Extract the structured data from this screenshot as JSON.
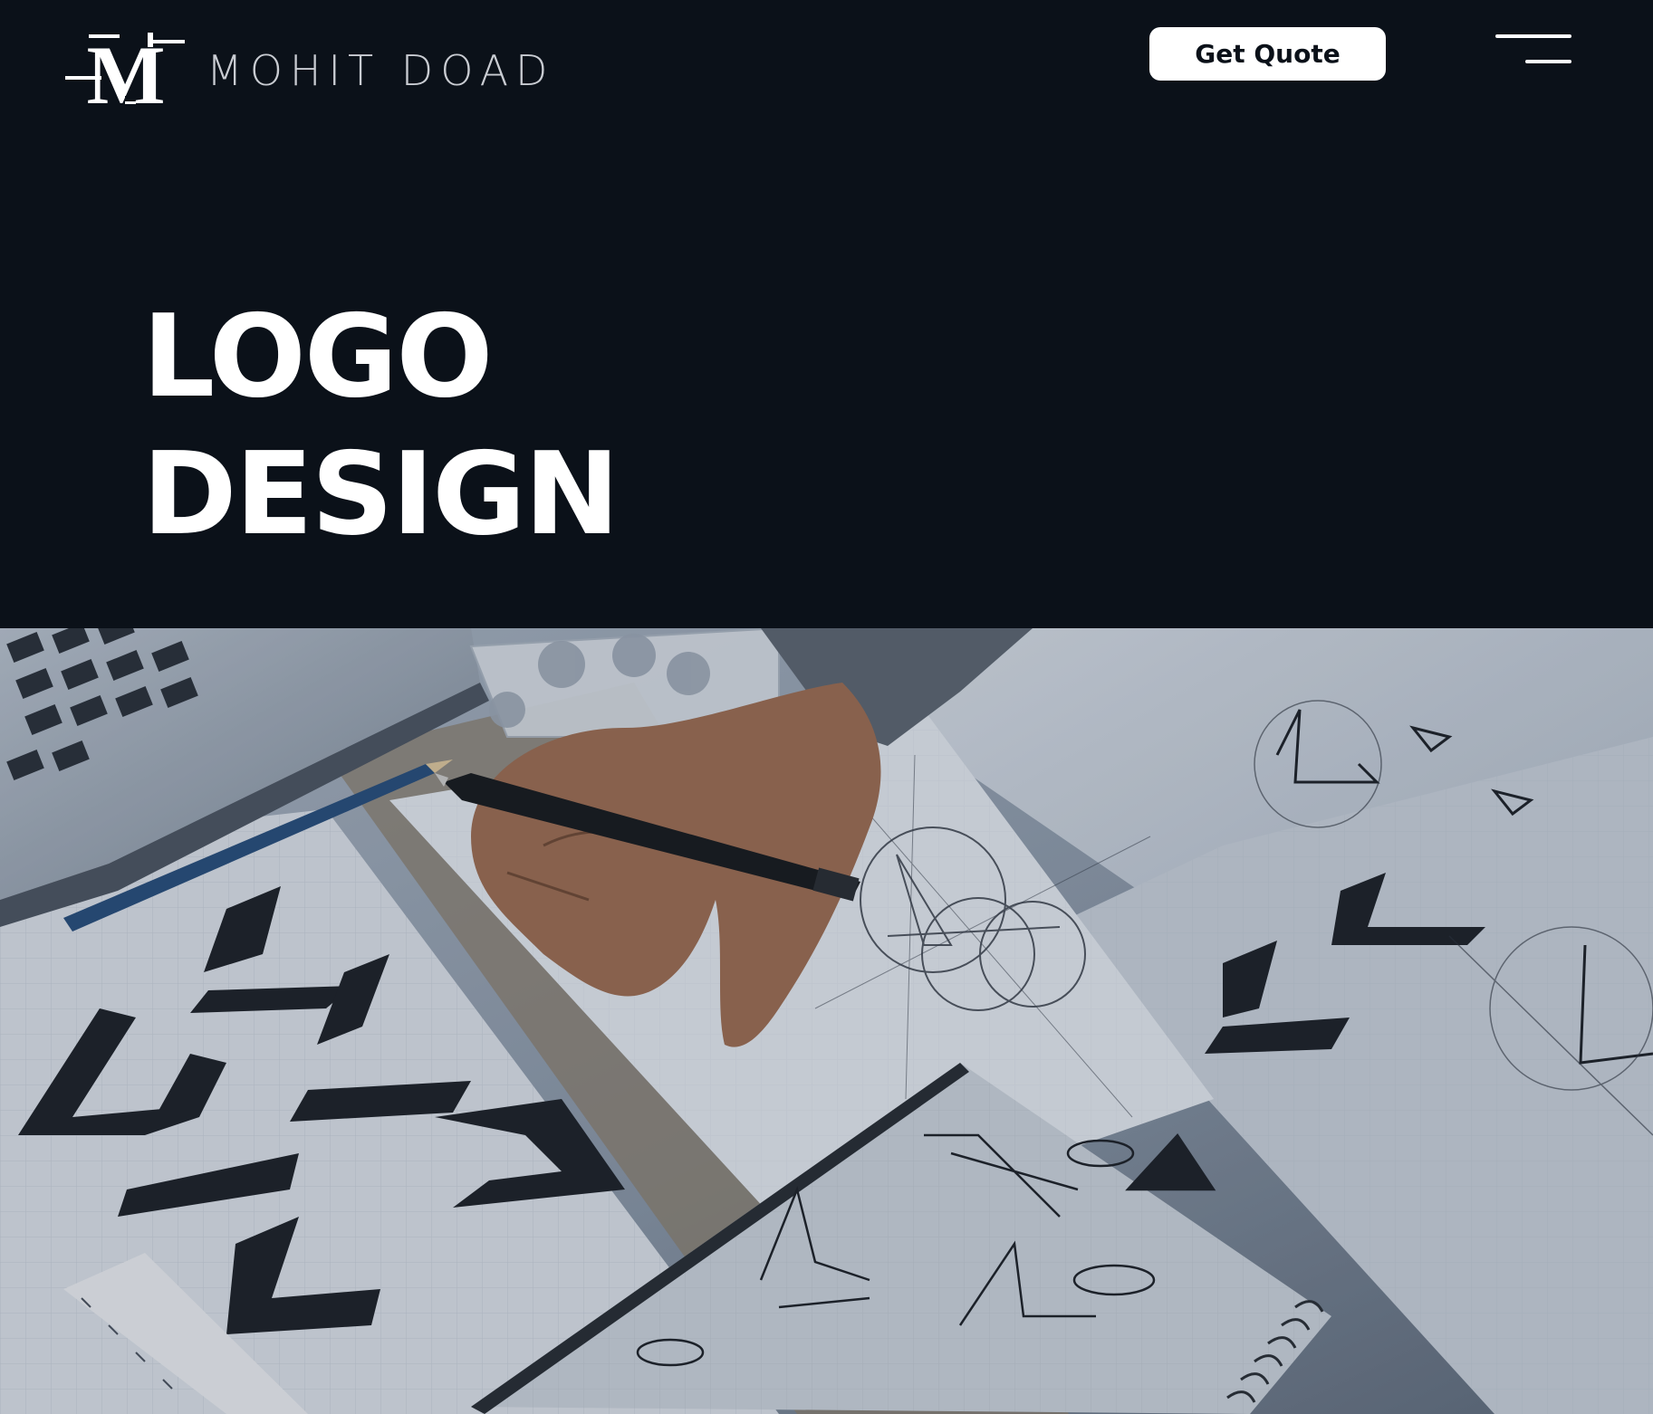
{
  "header": {
    "logo_letter": "M",
    "brand_name": "MOHIT DOAD",
    "cta_label": "Get Quote",
    "menu_icon": "hamburger-menu-icon"
  },
  "hero": {
    "title_line1": "LOGO",
    "title_line2": "DESIGN"
  },
  "image": {
    "subject": "photo-designer-sketching-logos",
    "icon": "photo-image"
  },
  "colors": {
    "background": "#0b1119",
    "text": "#ffffff",
    "brand_text": "#c9ccd2",
    "button_bg": "#ffffff",
    "button_text": "#0b1119"
  }
}
